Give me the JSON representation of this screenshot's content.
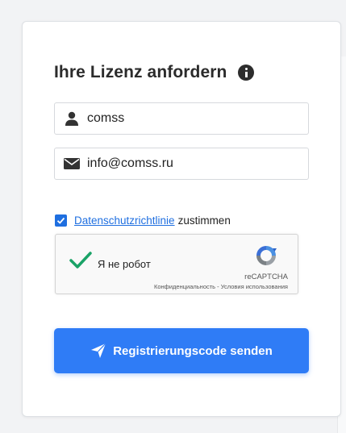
{
  "form": {
    "title": "Ihre Lizenz anfordern",
    "name_value": "comss",
    "email_value": "info@comss.ru",
    "privacy_link": "Datenschutzrichtlinie",
    "privacy_suffix": "zustimmen",
    "privacy_checked": true,
    "submit_label": "Registrierungscode senden"
  },
  "recaptcha": {
    "label": "Я не робот",
    "brand": "reCAPTCHA",
    "privacy": "Конфиденциальность",
    "separator": " - ",
    "terms": "Условия использования",
    "checked": true
  },
  "icons": {
    "info": "info-icon",
    "name": "user-icon",
    "email": "envelope-icon",
    "check": "checkmark-icon",
    "recaptcha": "recaptcha-logo-icon",
    "send": "paper-plane-icon"
  },
  "colors": {
    "accent": "#2f7cf6",
    "checkbox": "#1f6fe0",
    "link": "#1f6fe0",
    "recaptcha_check": "#1aa367"
  }
}
